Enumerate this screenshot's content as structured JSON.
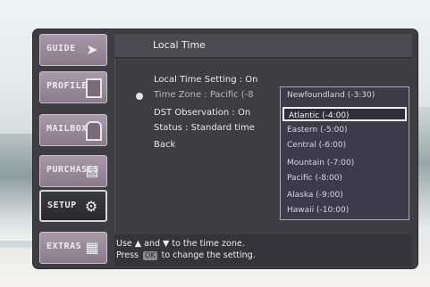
{
  "tabs": [
    {
      "label": "GUIDE",
      "icon": "arrow-right-icon"
    },
    {
      "label": "PROFILES",
      "icon": "document-icon"
    },
    {
      "label": "MAILBOX",
      "icon": "mailbox-icon"
    },
    {
      "label": "PURCHASES",
      "icon": "purchases-icon"
    },
    {
      "label": "SETUP",
      "icon": "setup-gear-icon"
    },
    {
      "label": "EXTRAS",
      "icon": "extras-grid-icon"
    }
  ],
  "active_tab": "SETUP",
  "screen": {
    "title": "Local Time"
  },
  "menu": {
    "items": [
      {
        "label": "Local Time Setting : On"
      },
      {
        "label": "Time Zone : Pacific (-8"
      },
      {
        "label": "DST Observation : On"
      },
      {
        "label": "Status : Standard time"
      },
      {
        "label": "Back"
      }
    ],
    "selected_index": 1
  },
  "time_zones": {
    "options": [
      {
        "label": "Newfoundland (-3:30)"
      },
      {
        "label": "Atlantic (-4:00)"
      },
      {
        "label": "Eastern (-5:00)"
      },
      {
        "label": "Central (-6:00)"
      },
      {
        "label": "Mountain (-7:00)"
      },
      {
        "label": "Pacific (-8:00)"
      },
      {
        "label": "Alaska (-9:00)"
      },
      {
        "label": "Hawaii (-10:00)"
      }
    ],
    "highlighted_index": 1
  },
  "help": {
    "line1_pre": "Use",
    "line1_mid": "and",
    "line1_post": "to the time zone.",
    "line2_pre": "Press",
    "ok_key": "OK",
    "line2_post": "to change the setting."
  }
}
